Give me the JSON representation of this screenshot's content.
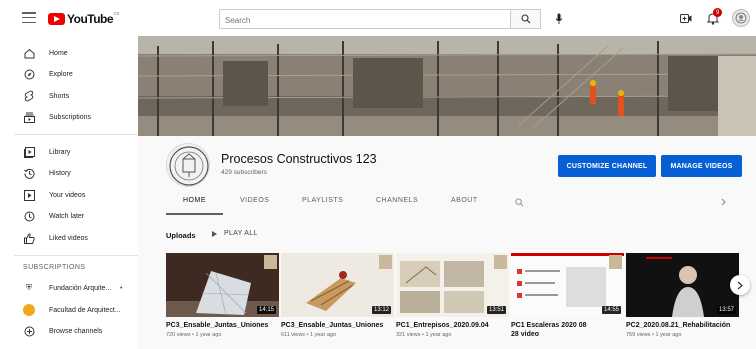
{
  "header": {
    "logo_text": "YouTube",
    "logo_superscript": "co",
    "search_placeholder": "Search",
    "notification_count": "9"
  },
  "sidebar": {
    "items": [
      {
        "label": "Home",
        "icon": "home-icon"
      },
      {
        "label": "Explore",
        "icon": "compass-icon"
      },
      {
        "label": "Shorts",
        "icon": "shorts-icon"
      },
      {
        "label": "Subscriptions",
        "icon": "subscriptions-icon"
      },
      {
        "label": "Library",
        "icon": "library-icon"
      },
      {
        "label": "History",
        "icon": "history-icon"
      },
      {
        "label": "Your videos",
        "icon": "your-videos-icon"
      },
      {
        "label": "Watch later",
        "icon": "clock-icon"
      },
      {
        "label": "Liked videos",
        "icon": "thumbs-up-icon"
      }
    ],
    "subscriptions_title": "SUBSCRIPTIONS",
    "subscriptions": [
      {
        "label": "Fundación Arquite...",
        "badge": "•"
      },
      {
        "label": "Facultad de Arquitect..."
      },
      {
        "label": "Browse channels"
      }
    ]
  },
  "channel": {
    "name": "Procesos Constructivos 123",
    "subscribers": "429 subscribers",
    "customize_label": "CUSTOMIZE CHANNEL",
    "manage_label": "MANAGE VIDEOS"
  },
  "tabs": [
    "HOME",
    "VIDEOS",
    "PLAYLISTS",
    "CHANNELS",
    "ABOUT"
  ],
  "uploads": {
    "title": "Uploads",
    "play_all": "PLAY ALL",
    "videos": [
      {
        "title": "PC3_Ensable_Juntas_Uniones",
        "meta": "720 views • 1 year ago",
        "duration": "14:15"
      },
      {
        "title": "PC3_Ensable_Juntas_Uniones",
        "meta": "611 views • 1 year ago",
        "duration": "13:12"
      },
      {
        "title": "PC1_Entrepisos_2020.09.04",
        "meta": "321 views • 1 year ago",
        "duration": "13:51"
      },
      {
        "title": "PC1 Escaleras 2020 08 28 video",
        "meta": "",
        "duration": "14:55"
      },
      {
        "title": "PC2_2020.08.21_Rehabilitación",
        "meta": "759 views • 1 year ago",
        "duration": "13:57"
      }
    ]
  },
  "colors": {
    "accent": "#065fd4",
    "brand": "#ee0000"
  }
}
